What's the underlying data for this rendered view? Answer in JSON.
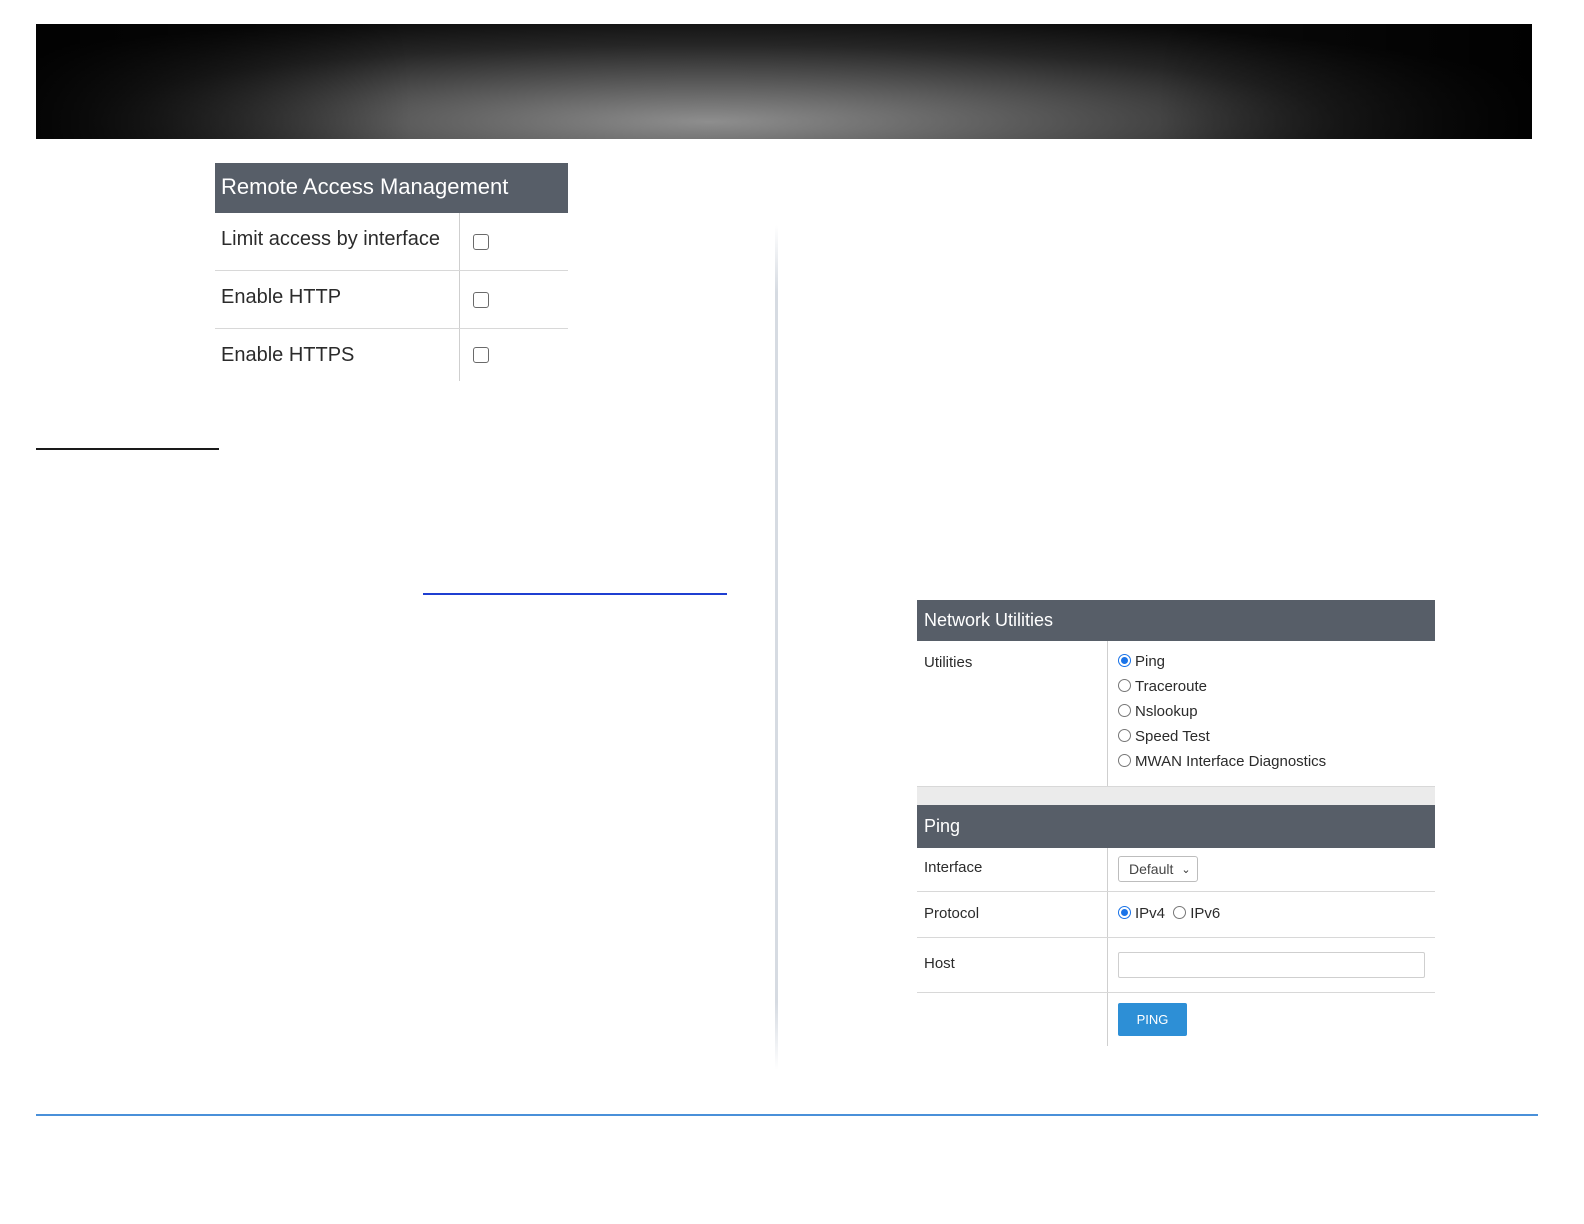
{
  "remote_access": {
    "title": "Remote Access Management",
    "rows": [
      {
        "label": "Limit access by interface",
        "checked": false
      },
      {
        "label": "Enable HTTP",
        "checked": false
      },
      {
        "label": "Enable HTTPS",
        "checked": false
      }
    ]
  },
  "network_utilities": {
    "title": "Network Utilities",
    "utilities_label": "Utilities",
    "options": [
      {
        "label": "Ping",
        "selected": true
      },
      {
        "label": "Traceroute",
        "selected": false
      },
      {
        "label": "Nslookup",
        "selected": false
      },
      {
        "label": "Speed Test",
        "selected": false
      },
      {
        "label": "MWAN Interface Diagnostics",
        "selected": false
      }
    ]
  },
  "ping": {
    "title": "Ping",
    "interface_label": "Interface",
    "interface_value": "Default",
    "protocol_label": "Protocol",
    "protocol_options": [
      {
        "label": "IPv4",
        "selected": true
      },
      {
        "label": "IPv6",
        "selected": false
      }
    ],
    "host_label": "Host",
    "host_value": "",
    "button_label": "PING"
  },
  "colors": {
    "panel_header": "#575e68",
    "button": "#2d8fd6",
    "radio_selected": "#1a73e8",
    "footer_line": "#4a90d9"
  }
}
